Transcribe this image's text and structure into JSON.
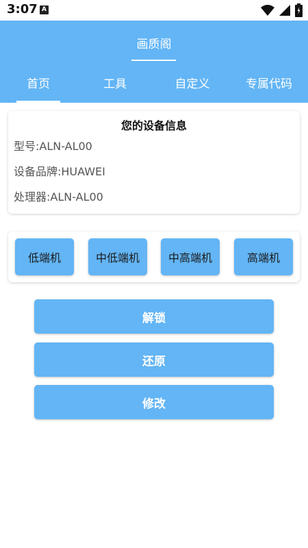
{
  "status_bar": {
    "time": "3:07",
    "notification_badge": "A"
  },
  "app_bar": {
    "title": "画质阁"
  },
  "tabs": [
    {
      "label": "首页",
      "selected": true
    },
    {
      "label": "工具",
      "selected": false
    },
    {
      "label": "自定义",
      "selected": false
    },
    {
      "label": "专属代码",
      "selected": false
    }
  ],
  "device_info": {
    "title": "您的设备信息",
    "model": "型号:ALN-AL00",
    "brand": "设备品牌:HUAWEI",
    "processor": "处理器:ALN-AL00"
  },
  "tiers": [
    {
      "label": "低端机"
    },
    {
      "label": "中低端机"
    },
    {
      "label": "中高端机"
    },
    {
      "label": "高端机"
    }
  ],
  "actions": {
    "unlock": "解锁",
    "restore": "还原",
    "modify": "修改"
  },
  "colors": {
    "accent": "#63b5f5",
    "background": "#ffffff"
  }
}
